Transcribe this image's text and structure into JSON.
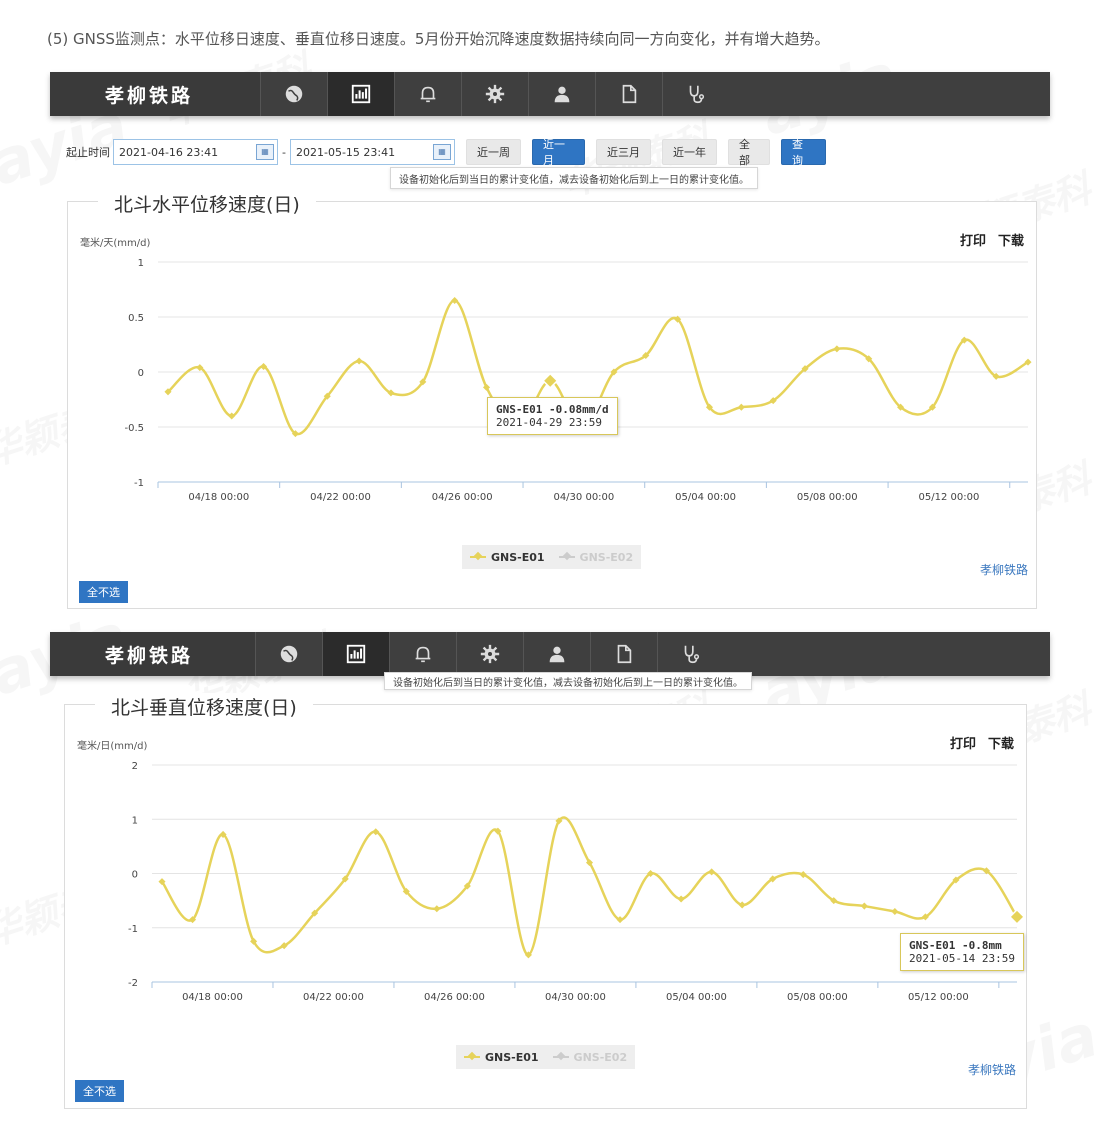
{
  "intro": "(5) GNSS监测点：水平位移日速度、垂直位移日速度。5月份开始沉降速度数据持续向同一方向变化，并有增大趋势。",
  "nav": {
    "brand": "孝柳铁路",
    "icons": [
      "globe-icon",
      "bar-chart-icon",
      "bell-icon",
      "gear-icon",
      "user-icon",
      "document-icon",
      "stethoscope-icon"
    ]
  },
  "query": {
    "label": "起止时间",
    "start": "2021-04-16 23:41",
    "end": "2021-05-15 23:41",
    "separator": "-",
    "buttons": [
      "近一周",
      "近一月",
      "近三月",
      "近一年",
      "全部"
    ],
    "active_button": "近一月",
    "submit": "查 询",
    "hint": "设备初始化后到当日的累计变化值，减去设备初始化后到上一日的累计变化值。"
  },
  "colors": {
    "series": "#e6d35a",
    "inactive": "#cccccc",
    "accent": "#2f75c3",
    "navbar": "#3f3f3f"
  },
  "watermarks": [
    "ayia",
    "华颖泰科"
  ],
  "chart1": {
    "title": "北斗水平位移速度(日)",
    "unit": "毫米/天(mm/d)",
    "print": "打印",
    "download": "下载",
    "credit": "孝柳铁路",
    "select_all": "全不选",
    "tooltip_line1": "GNS-E01 -0.08mm/d",
    "tooltip_line2": "2021-04-29 23:59"
  },
  "chart2": {
    "title": "北斗垂直位移速度(日)",
    "unit": "毫米/日(mm/d)",
    "print": "打印",
    "download": "下载",
    "credit": "孝柳铁路",
    "select_all": "全不选",
    "tooltip_line1": "GNS-E01 -0.8mm",
    "tooltip_line2": "2021-05-14 23:59",
    "hint_partial": "设备初始化后到当日的累计变化值，减去设备初始化后到上一日的累计变化值。"
  },
  "chart_data": [
    {
      "type": "line",
      "title": "北斗水平位移速度(日)",
      "ylabel": "毫米/天(mm/d)",
      "ylim": [
        -1,
        1
      ],
      "yticks": [
        "1",
        "0.5",
        "0",
        "-0.5",
        "-1"
      ],
      "xticks": [
        "04/18 00:00",
        "04/22 00:00",
        "04/26 00:00",
        "04/30 00:00",
        "05/04 00:00",
        "05/08 00:00",
        "05/12 00:00"
      ],
      "x": [
        "04/16",
        "04/17",
        "04/18",
        "04/19",
        "04/20",
        "04/21",
        "04/22",
        "04/23",
        "04/24",
        "04/25",
        "04/26",
        "04/27",
        "04/28",
        "04/29",
        "04/30",
        "05/01",
        "05/02",
        "05/03",
        "05/04",
        "05/05",
        "05/06",
        "05/07",
        "05/08",
        "05/09",
        "05/10",
        "05/11",
        "05/12",
        "05/13",
        "05/14",
        "05/15"
      ],
      "grid": true,
      "legend": "bottom-center",
      "series": [
        {
          "name": "GNS-E01",
          "values": [
            -0.18,
            0.04,
            -0.4,
            0.05,
            -0.56,
            -0.22,
            0.1,
            -0.19,
            -0.09,
            0.65,
            -0.14,
            -0.5,
            -0.08,
            -0.5,
            0.0,
            0.15,
            0.48,
            -0.32,
            -0.32,
            -0.26,
            0.03,
            0.21,
            0.12,
            -0.32,
            -0.32,
            0.29,
            -0.04,
            0.09
          ],
          "active": true
        },
        {
          "name": "GNS-E02",
          "values": [],
          "active": false
        }
      ]
    },
    {
      "type": "line",
      "title": "北斗垂直位移速度(日)",
      "ylabel": "毫米/日(mm/d)",
      "ylim": [
        -2,
        2
      ],
      "yticks": [
        "2",
        "1",
        "0",
        "-1",
        "-2"
      ],
      "xticks": [
        "04/18 00:00",
        "04/22 00:00",
        "04/26 00:00",
        "04/30 00:00",
        "05/04 00:00",
        "05/08 00:00",
        "05/12 00:00"
      ],
      "grid": true,
      "legend": "bottom-center",
      "series": [
        {
          "name": "GNS-E01",
          "values": [
            -0.15,
            -0.85,
            0.72,
            -1.25,
            -1.33,
            -0.73,
            -0.1,
            0.77,
            -0.33,
            -0.65,
            -0.23,
            0.78,
            -1.5,
            0.97,
            0.2,
            -0.85,
            0.0,
            -0.47,
            0.03,
            -0.58,
            -0.1,
            -0.02,
            -0.5,
            -0.6,
            -0.7,
            -0.8,
            -0.12,
            0.05,
            -0.8
          ],
          "active": true
        },
        {
          "name": "GNS-E02",
          "values": [],
          "active": false
        }
      ]
    }
  ]
}
